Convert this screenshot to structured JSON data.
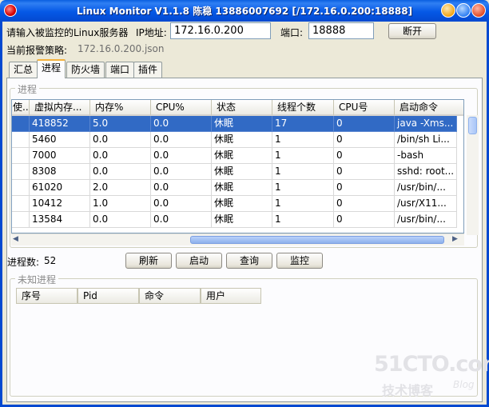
{
  "window": {
    "title": "Linux Monitor V1.1.8 陈稳 13886007692 [/172.16.0.200:18888]"
  },
  "connect": {
    "prompt_label": "请输入被监控的Linux服务器",
    "ip_label": "IP地址:",
    "ip_value": "172.16.0.200",
    "port_label": "端口:",
    "port_value": "18888",
    "disconnect_label": "断开"
  },
  "policy": {
    "label": "当前报警策略:",
    "value": "172.16.0.200.json"
  },
  "tabs": [
    {
      "label": "汇总",
      "active": false
    },
    {
      "label": "进程",
      "active": true
    },
    {
      "label": "防火墙",
      "active": false
    },
    {
      "label": "端口",
      "active": false
    },
    {
      "label": "插件",
      "active": false
    }
  ],
  "process_group": {
    "title": "进程",
    "columns": [
      "使...",
      "虚拟内存...",
      "内存%",
      "CPU%",
      "状态",
      "线程个数",
      "CPU号",
      "启动命令"
    ],
    "rows": [
      [
        "",
        "418852",
        "5.0",
        "0.0",
        "休眠",
        "17",
        "0",
        "java -Xms..."
      ],
      [
        "",
        "5460",
        "0.0",
        "0.0",
        "休眠",
        "1",
        "0",
        "/bin/sh Li..."
      ],
      [
        "",
        "7000",
        "0.0",
        "0.0",
        "休眠",
        "1",
        "0",
        "-bash"
      ],
      [
        "",
        "8308",
        "0.0",
        "0.0",
        "休眠",
        "1",
        "0",
        "sshd: root..."
      ],
      [
        "",
        "61020",
        "2.0",
        "0.0",
        "休眠",
        "1",
        "0",
        "/usr/bin/..."
      ],
      [
        "",
        "10412",
        "1.0",
        "0.0",
        "休眠",
        "1",
        "0",
        "/usr/X11..."
      ],
      [
        "",
        "13584",
        "0.0",
        "0.0",
        "休眠",
        "1",
        "0",
        "/usr/bin/..."
      ]
    ],
    "selected_row": 0
  },
  "actions": {
    "count_label": "进程数:",
    "count_value": "52",
    "refresh_label": "刷新",
    "start_label": "启动",
    "query_label": "查询",
    "monitor_label": "监控"
  },
  "unknown_group": {
    "title": "未知进程",
    "columns": [
      "序号",
      "Pid",
      "命令",
      "用户"
    ]
  },
  "watermark": {
    "line1": "51CTO.com",
    "line2": "技术博客",
    "line3": "Blog"
  }
}
